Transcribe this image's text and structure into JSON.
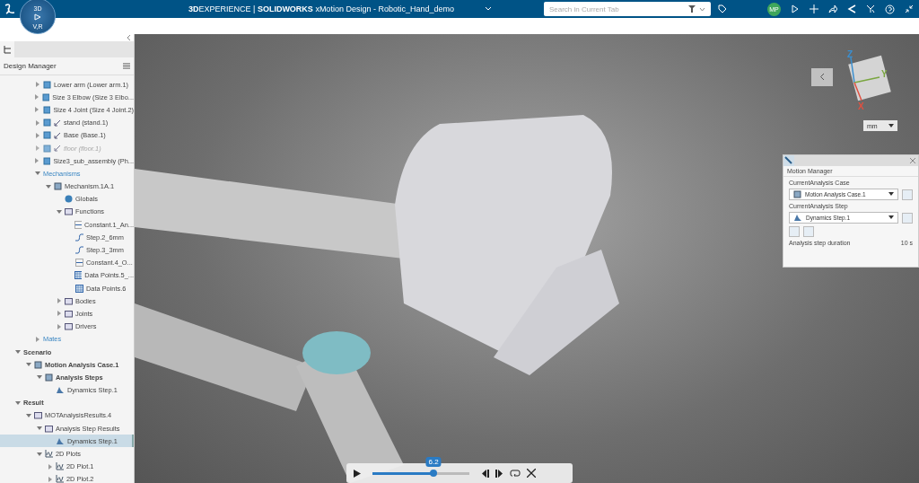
{
  "top_bar": {
    "compass_labels": [
      "3D",
      "V,R"
    ],
    "title": "**3D**EXPERIENCE | **SOLIDWORKS** xMotion Design - Robotic_Hand_demo",
    "search": {
      "placeholder": "Search in Current Tab"
    },
    "avatar": "MP"
  },
  "design_manager": {
    "title": "Design Manager",
    "tree": [
      {
        "label": "Lower arm (Lower arm.1)",
        "kind": "part",
        "expanded": false,
        "disabled": false,
        "selected": false
      },
      {
        "label": "Size 3 Elbow (Size 3 Elbo...",
        "kind": "part",
        "expanded": false,
        "disabled": false,
        "selected": false
      },
      {
        "label": "Size 4 Joint (Size 4 Joint.2)",
        "kind": "part",
        "expanded": false,
        "disabled": false,
        "selected": false
      },
      {
        "label": "stand (stand.1)",
        "kind": "fixed-part",
        "expanded": false,
        "disabled": false,
        "selected": false
      },
      {
        "label": "Base (Base.1)",
        "kind": "fixed-part",
        "expanded": false,
        "disabled": false,
        "selected": false
      },
      {
        "label": "floor (floor.1)",
        "kind": "fixed-part",
        "expanded": false,
        "disabled": true,
        "selected": false
      },
      {
        "label": "Size3_sub_assembly (Ph...",
        "kind": "part",
        "expanded": false,
        "disabled": false,
        "selected": false
      },
      {
        "label": "Mechanisms",
        "kind": "section",
        "expanded": true,
        "disabled": false,
        "selected": false,
        "children": [
          {
            "label": "Mechanism.1A.1",
            "kind": "node",
            "expanded": true,
            "disabled": false,
            "selected": false,
            "children": [
              {
                "label": "Globals",
                "kind": "globe",
                "disabled": false,
                "selected": false
              },
              {
                "label": "Functions",
                "kind": "folder",
                "expanded": true,
                "disabled": false,
                "selected": false,
                "children": [
                  {
                    "label": "Constant.1_An...",
                    "kind": "constant",
                    "disabled": false,
                    "selected": false
                  },
                  {
                    "label": "Step.2_6mm",
                    "kind": "step-function",
                    "disabled": false,
                    "selected": false
                  },
                  {
                    "label": "Step.3_3mm",
                    "kind": "step-function",
                    "disabled": false,
                    "selected": false
                  },
                  {
                    "label": "Constant.4_O...",
                    "kind": "constant",
                    "disabled": false,
                    "selected": false
                  },
                  {
                    "label": "Data Points.5_...",
                    "kind": "table",
                    "disabled": false,
                    "selected": false
                  },
                  {
                    "label": "Data Points.6",
                    "kind": "table",
                    "disabled": false,
                    "selected": false
                  }
                ]
              },
              {
                "label": "Bodies",
                "kind": "folder",
                "expanded": false,
                "disabled": false,
                "selected": false
              },
              {
                "label": "Joints",
                "kind": "folder",
                "expanded": false,
                "disabled": false,
                "selected": false
              },
              {
                "label": "Drivers",
                "kind": "folder",
                "expanded": false,
                "disabled": false,
                "selected": false
              }
            ]
          }
        ]
      },
      {
        "label": "Mates",
        "kind": "section",
        "expanded": false,
        "disabled": false,
        "selected": false
      },
      {
        "label": "Scenario",
        "kind": "heading",
        "expanded": true,
        "disabled": false,
        "selected": false,
        "children": [
          {
            "label": "Motion Analysis Case.1",
            "kind": "case",
            "expanded": true,
            "disabled": false,
            "selected": false,
            "children": [
              {
                "label": "Analysis Steps",
                "kind": "case",
                "expanded": true,
                "disabled": false,
                "selected": false,
                "children": [
                  {
                    "label": "Dynamics Step.1",
                    "kind": "step",
                    "disabled": false,
                    "selected": false
                  }
                ]
              }
            ]
          }
        ]
      },
      {
        "label": "Result",
        "kind": "heading",
        "expanded": true,
        "disabled": false,
        "selected": false,
        "children": [
          {
            "label": "MOTAnalysisResults.4",
            "kind": "folder",
            "expanded": true,
            "disabled": false,
            "selected": false,
            "children": [
              {
                "label": "Analysis Step Results",
                "kind": "folder",
                "expanded": true,
                "disabled": false,
                "selected": false,
                "children": [
                  {
                    "label": "Dynamics Step.1",
                    "kind": "step",
                    "disabled": false,
                    "selected": true
                  }
                ]
              },
              {
                "label": "2D Plots",
                "kind": "plot",
                "expanded": true,
                "disabled": false,
                "selected": false,
                "children": [
                  {
                    "label": "2D Plot.1",
                    "kind": "plot",
                    "expanded": false,
                    "disabled": false,
                    "selected": false
                  },
                  {
                    "label": "2D Plot.2",
                    "kind": "plot",
                    "expanded": false,
                    "disabled": false,
                    "selected": false
                  }
                ]
              }
            ]
          }
        ]
      }
    ]
  },
  "view_cube": {
    "axes": [
      "Z",
      "Y",
      "X"
    ],
    "units": "mm"
  },
  "motion_manager": {
    "title": "Motion Manager",
    "case_label": "CurrentAnalysis Case",
    "case_value": "Motion Analysis Case.1",
    "step_label": "CurrentAnalysis Step",
    "step_value": "Dynamics Step.1",
    "duration_label": "Analysis step duration",
    "duration_value": "10 s"
  },
  "player": {
    "time": "6.2",
    "level": 0.63
  }
}
